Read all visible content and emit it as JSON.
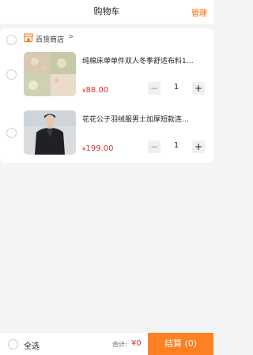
{
  "header": {
    "title": "购物车",
    "manage_label": "管理"
  },
  "store": {
    "name": "百货商店",
    "chevron": ">"
  },
  "items": [
    {
      "title": "纯棉床单单件双人冬季舒适布料1…",
      "currency": "¥",
      "price": "88.00",
      "quantity": "1"
    },
    {
      "title": "花花公子羽绒服男士加厚短款连…",
      "currency": "¥",
      "price": "199.00",
      "quantity": "1"
    }
  ],
  "qty_controls": {
    "minus": "−",
    "plus": "+"
  },
  "footer": {
    "select_all_label": "全选",
    "total_label": "合计:",
    "total_value": "¥0",
    "checkout_label": "结算 (0)"
  },
  "colors": {
    "accent": "#ff6a00",
    "checkout_bg": "#ff7f23",
    "price": "#d6332a"
  },
  "icons": [
    "store-icon",
    "chevron-right-icon",
    "minus-icon",
    "plus-icon"
  ]
}
